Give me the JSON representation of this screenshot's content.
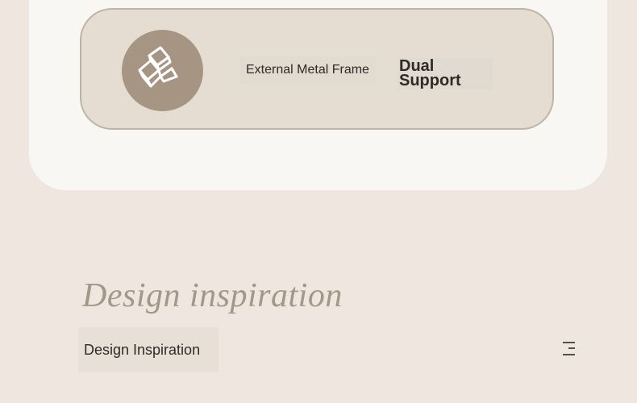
{
  "feature": {
    "icon": "gold-bars-icon",
    "frame_label": "External Metal Frame",
    "support_label_line1": "Dual",
    "support_label_line2": "Support"
  },
  "section": {
    "headline": "Design inspiration",
    "subheading": "Design Inspiration",
    "menu_icon": "menu-icon"
  },
  "colors": {
    "background": "#efe7df",
    "panel": "#f9f7f3",
    "card": "#e5ddd2",
    "card_border": "#bfb3a6",
    "icon_circle": "#a69583",
    "headline": "#a39787",
    "text": "#2e2a27"
  }
}
